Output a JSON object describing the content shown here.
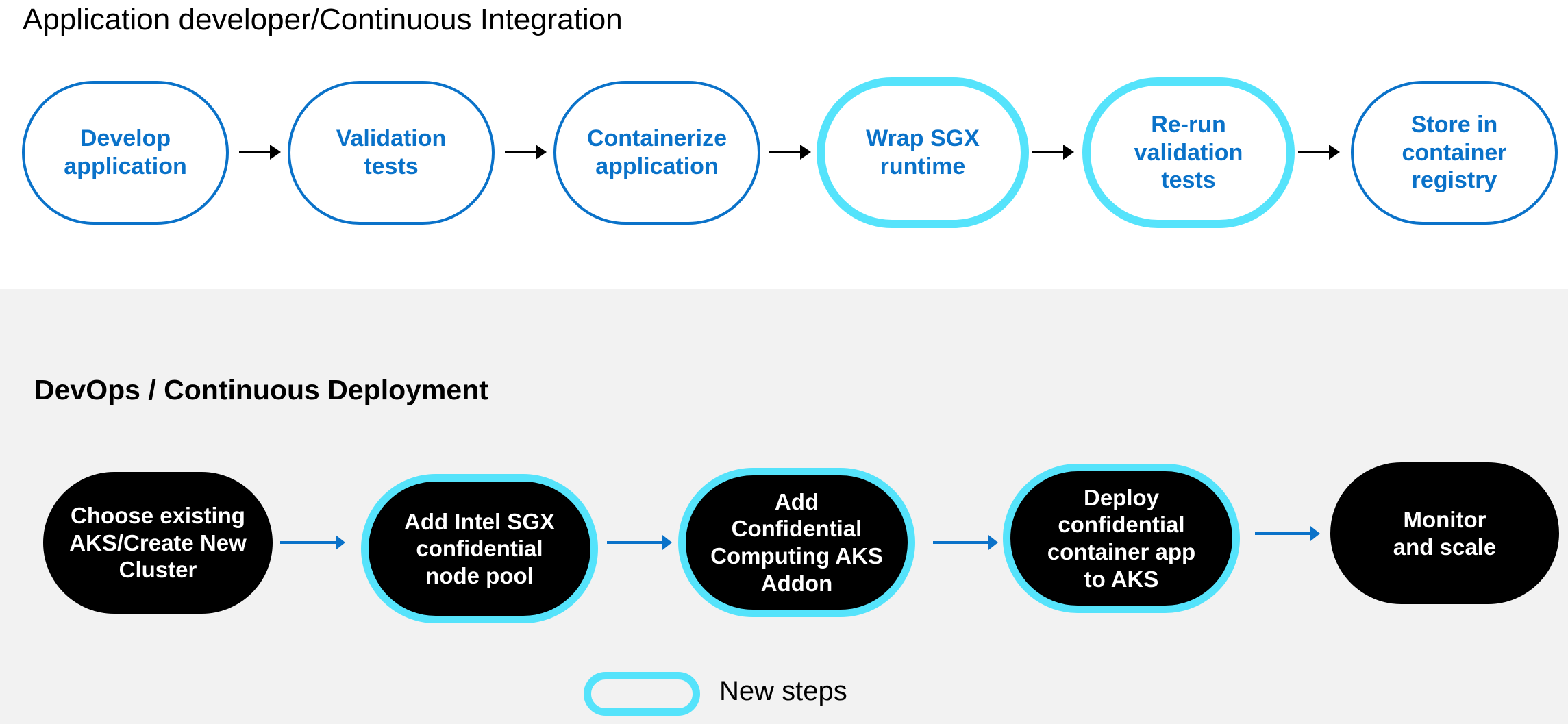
{
  "colors": {
    "step_border": "#0a72c9",
    "new_step_border": "#55e3fb",
    "step_text_top": "#0a72c9",
    "bottom_node_fill": "#000000",
    "bottom_background": "#f2f2f2",
    "arrow_top": "#000000",
    "arrow_bottom": "#0a72c9"
  },
  "ci": {
    "title": "Application developer/Continuous Integration",
    "steps": [
      {
        "label": "Develop\napplication",
        "new": false
      },
      {
        "label": "Validation\ntests",
        "new": false
      },
      {
        "label": "Containerize\napplication",
        "new": false
      },
      {
        "label": "Wrap SGX\nruntime",
        "new": true
      },
      {
        "label": "Re-run\nvalidation\ntests",
        "new": true
      },
      {
        "label": "Store in\ncontainer\nregistry",
        "new": false
      }
    ]
  },
  "cd": {
    "title": "DevOps / Continuous Deployment",
    "steps": [
      {
        "label": "Choose existing\nAKS/Create New\nCluster",
        "new": false
      },
      {
        "label": "Add Intel SGX\nconfidential\nnode pool",
        "new": true
      },
      {
        "label": "Add\nConfidential\nComputing AKS\nAddon",
        "new": true
      },
      {
        "label": "Deploy\nconfidential\ncontainer app\nto AKS",
        "new": true
      },
      {
        "label": "Monitor\nand scale",
        "new": false
      }
    ]
  },
  "legend": {
    "icon": "new-step-pill-icon",
    "label": "New steps"
  }
}
